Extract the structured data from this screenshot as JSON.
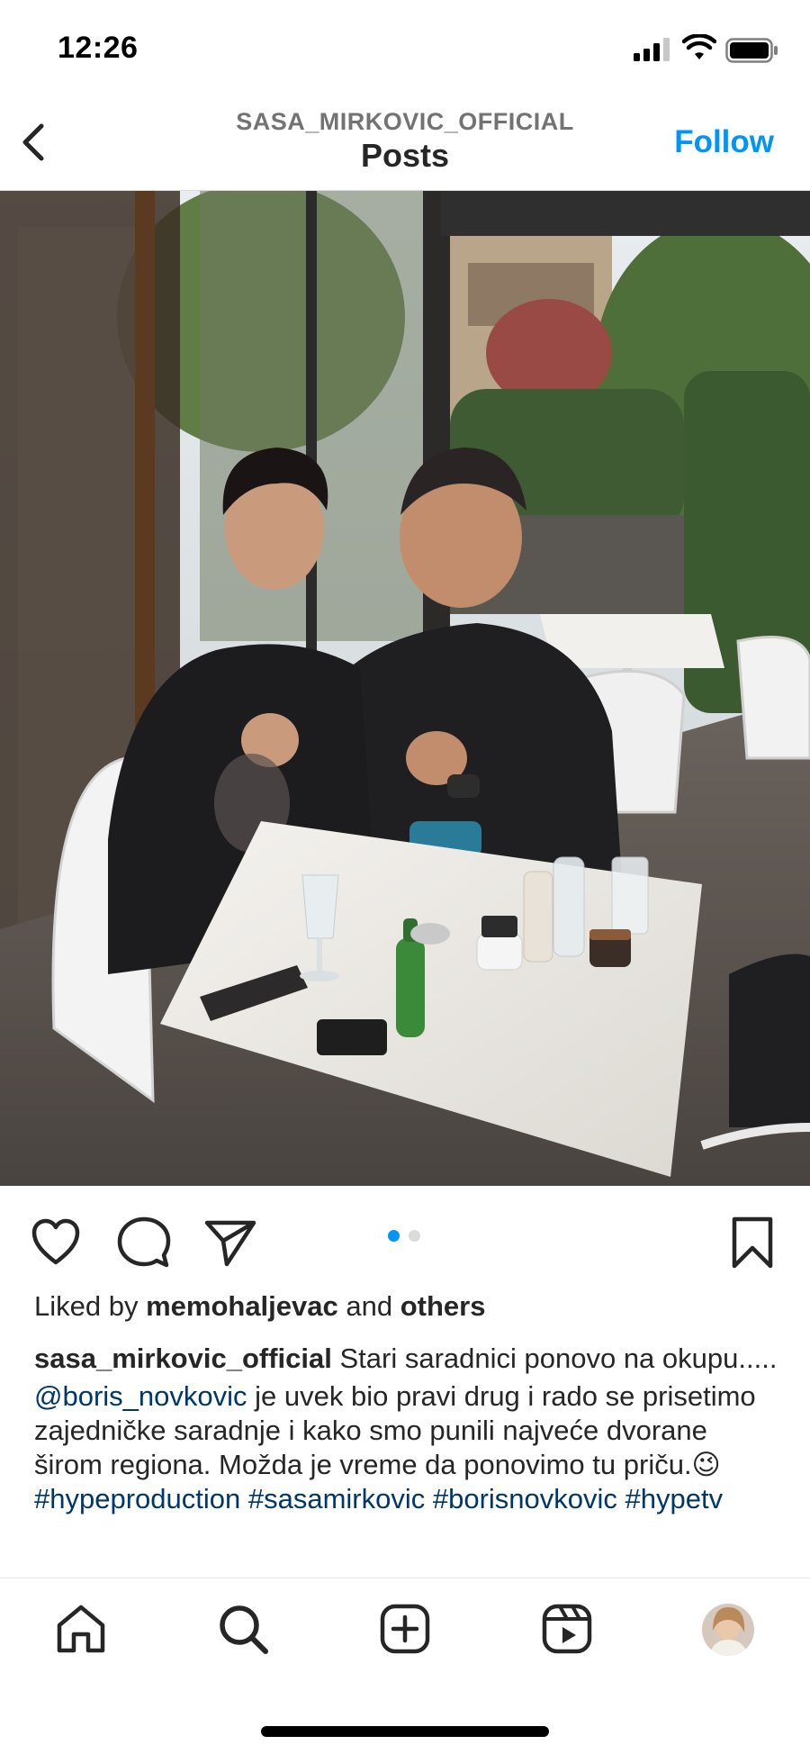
{
  "status_bar": {
    "time": "12:26"
  },
  "header": {
    "username": "SASA_MIRKOVIC_OFFICIAL",
    "title": "Posts",
    "follow_label": "Follow"
  },
  "carousel": {
    "current": 1,
    "total": 2,
    "accent_color": "#0095f6"
  },
  "icons": {
    "like": "heart-icon",
    "comment": "comment-icon",
    "share": "paper-plane-icon",
    "save": "bookmark-icon",
    "back": "chevron-left-icon"
  },
  "likes": {
    "prefix": "Liked by ",
    "user": "memohaljevac",
    "middle": " and ",
    "others": "others"
  },
  "caption": {
    "author": "sasa_mirkovic_official",
    "text": " Stari saradnici ponovo na okupu.....",
    "mention": "@boris_novkovic",
    "body": " je uvek bio pravi drug i rado se prisetimo zajedničke saradnje i kako smo punili najveće dvorane širom regiona. Možda je vreme da ponovimo tu priču.😉 ",
    "hashtag1": "#hypeproduction",
    "hashtags_rest": "#sasamirkovic #borisnovkovic #hypetv"
  },
  "bottom_nav": [
    "home-icon",
    "search-icon",
    "new-post-icon",
    "reels-icon",
    "profile-avatar"
  ]
}
